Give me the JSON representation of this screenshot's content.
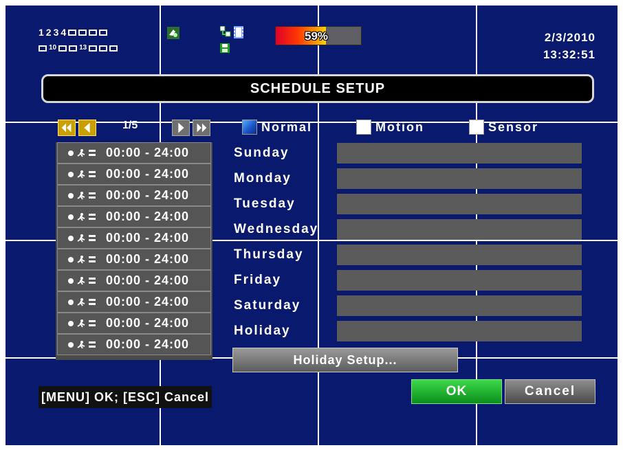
{
  "status_bar": {
    "channel_row1": [
      "1",
      "2",
      "3",
      "4"
    ],
    "channel_row2_labels": [
      "10",
      "13"
    ],
    "hdd_usage_percent": 59,
    "hdd_usage_text": "59%",
    "date": "2/3/2010",
    "time": "13:32:51"
  },
  "title": "SCHEDULE SETUP",
  "pagination": {
    "indicator": "1/5"
  },
  "legend": {
    "normal": "Normal",
    "motion": "Motion",
    "sensor": "Sensor"
  },
  "time_slots": [
    "00:00 - 24:00",
    "00:00 - 24:00",
    "00:00 - 24:00",
    "00:00 - 24:00",
    "00:00 - 24:00",
    "00:00 - 24:00",
    "00:00 - 24:00",
    "00:00 - 24:00",
    "00:00 - 24:00",
    "00:00 - 24:00"
  ],
  "days": [
    "Sunday",
    "Monday",
    "Tuesday",
    "Wednesday",
    "Thursday",
    "Friday",
    "Saturday",
    "Holiday"
  ],
  "buttons": {
    "holiday_setup": "Holiday Setup...",
    "ok": "OK",
    "cancel": "Cancel"
  },
  "hint": "[MENU] OK; [ESC] Cancel",
  "colors": {
    "background": "#091a6e",
    "ok_green": "#1fb82e",
    "day_bar": "#5b5b5b"
  }
}
